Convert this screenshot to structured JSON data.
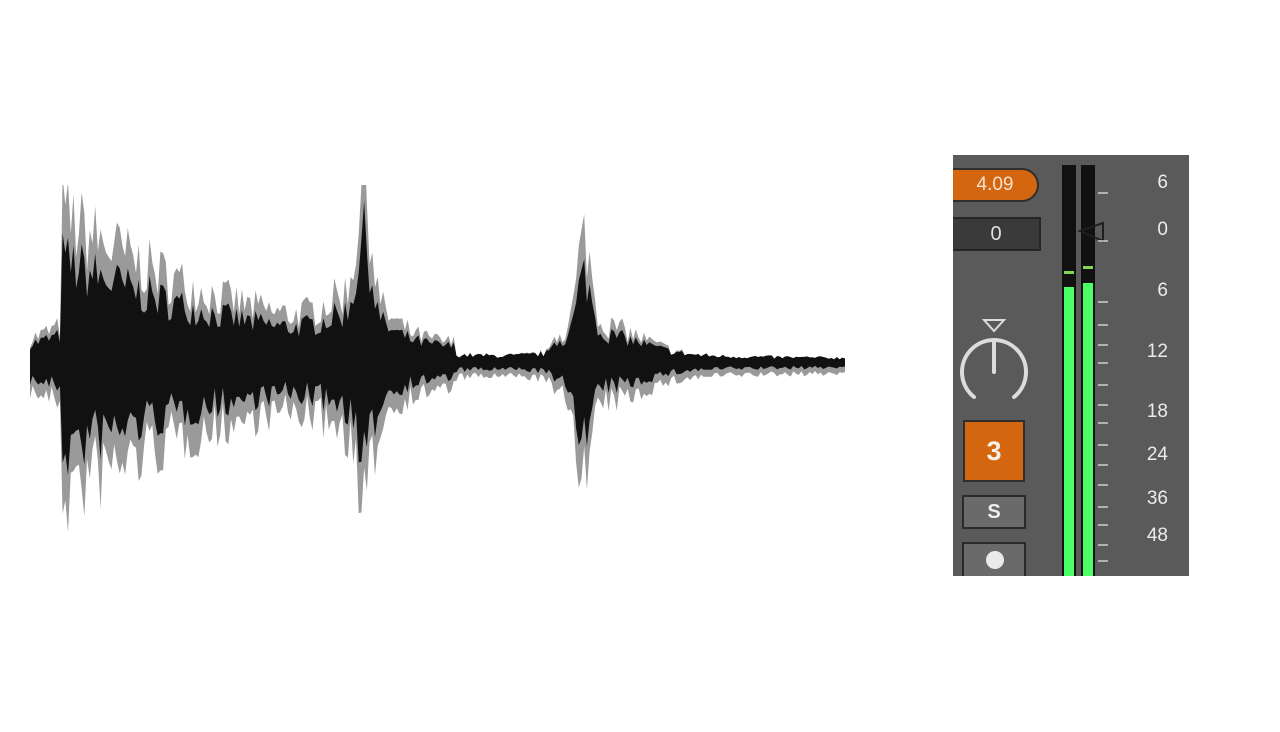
{
  "waveform": {
    "color": "#111111",
    "shade_color": "#9a9a9a"
  },
  "mixer_strip": {
    "volume_value": "4.09",
    "pan_value": "0",
    "track_number": "3",
    "solo_label": "S",
    "meter_scale": [
      "6",
      "0",
      "6",
      "12",
      "18",
      "24",
      "36",
      "48"
    ],
    "colors": {
      "panel_bg": "#5a5a5a",
      "accent": "#d4660f",
      "meter_green": "#4dff66",
      "meter_bg": "#111111"
    }
  }
}
